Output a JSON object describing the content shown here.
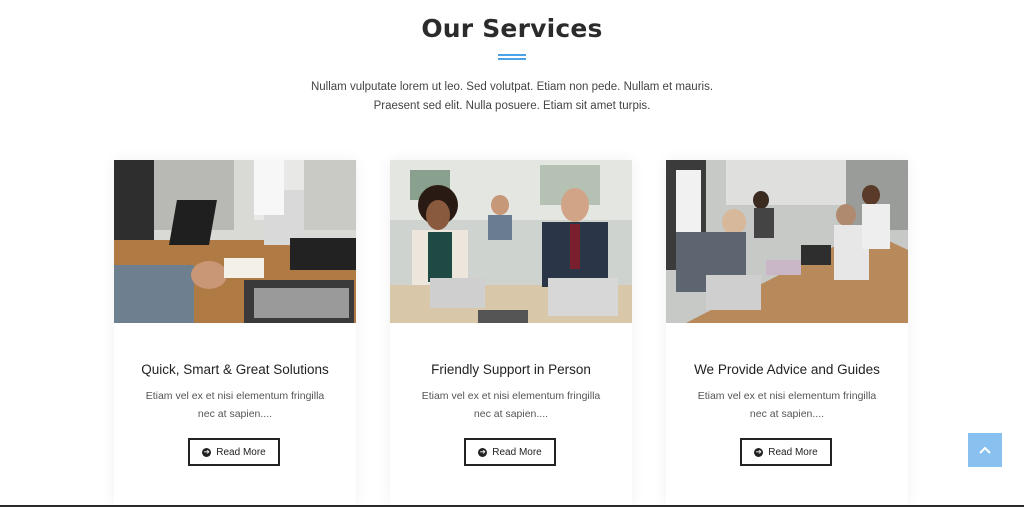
{
  "section": {
    "title": "Our Services",
    "intro_line1": "Nullam vulputate lorem ut leo. Sed volutpat. Etiam non pede. Nullam et mauris.",
    "intro_line2": "Praesent sed elit. Nulla posuere. Etiam sit amet turpis.",
    "accent_color": "#4da3e8"
  },
  "cards": [
    {
      "title": "Quick, Smart & Great Solutions",
      "desc_line1": "Etiam vel ex et nisi elementum fringilla",
      "desc_line2": "nec at sapien....",
      "button_label": "Read More",
      "image": "office-laptop-photo"
    },
    {
      "title": "Friendly Support in Person",
      "desc_line1": "Etiam vel ex et nisi elementum fringilla",
      "desc_line2": "nec at sapien....",
      "button_label": "Read More",
      "image": "team-meeting-photo"
    },
    {
      "title": "We Provide Advice and Guides",
      "desc_line1": "Etiam vel ex et nisi elementum fringilla",
      "desc_line2": "nec at sapien....",
      "button_label": "Read More",
      "image": "coworking-photo"
    }
  ],
  "back_to_top": {
    "icon": "chevron-up-icon",
    "color": "#88c0f0"
  }
}
